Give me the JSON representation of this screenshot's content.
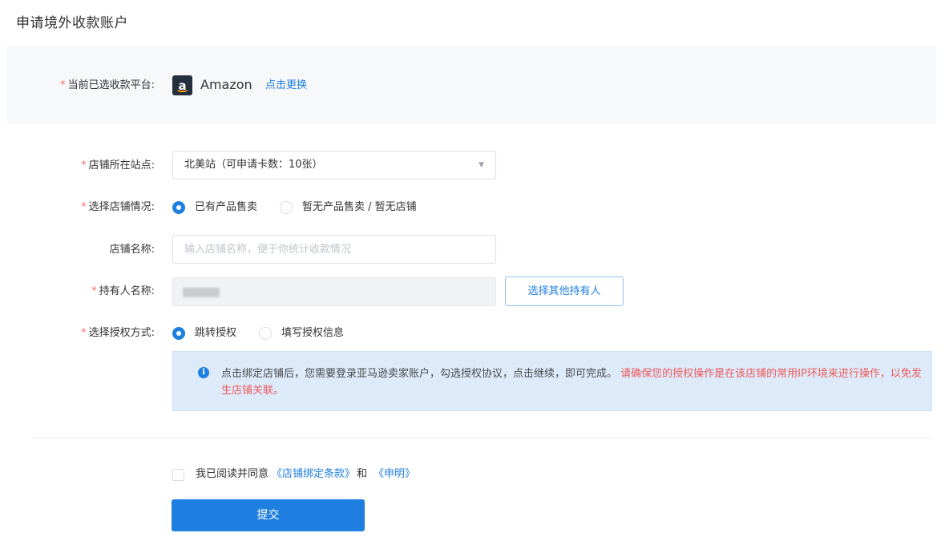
{
  "page": {
    "title": "申请境外收款账户"
  },
  "platform": {
    "label": "当前已选收款平台:",
    "required_mark": "*",
    "logo_letter": "a",
    "name": "Amazon",
    "change_link": "点击更换"
  },
  "site": {
    "label": "店铺所在站点:",
    "required_mark": "*",
    "selected": "北美站（可申请卡数：10张）"
  },
  "store_status": {
    "label": "选择店铺情况:",
    "required_mark": "*",
    "options": [
      {
        "label": "已有产品售卖",
        "checked": true
      },
      {
        "label": "暂无产品售卖 / 暂无店铺",
        "checked": false
      }
    ]
  },
  "store_name": {
    "label": "店铺名称:",
    "placeholder": "输入店铺名称，便于你统计收款情况",
    "value": ""
  },
  "holder": {
    "label": "持有人名称:",
    "required_mark": "*",
    "button": "选择其他持有人"
  },
  "auth_method": {
    "label": "选择授权方式:",
    "required_mark": "*",
    "options": [
      {
        "label": "跳转授权",
        "checked": true
      },
      {
        "label": "填写授权信息",
        "checked": false
      }
    ]
  },
  "info": {
    "icon": "info-icon",
    "icon_glyph": "i",
    "text": "点击绑定店铺后，您需要登录亚马逊卖家账户，勾选授权协议，点击继续，即可完成。",
    "warning": "请确保您的授权操作是在该店铺的常用IP环境来进行操作，以免发生店铺关联。"
  },
  "agreement": {
    "checked": false,
    "prefix": "我已阅读并同意",
    "terms_link": "《店铺绑定条款》",
    "conjunction": "和",
    "statement_link": "《申明》"
  },
  "submit": {
    "label": "提交"
  },
  "colors": {
    "primary": "#1f7fe0",
    "required": "#f56c6c",
    "warning_text": "#ef5b5b",
    "info_bg": "#dceafa"
  }
}
